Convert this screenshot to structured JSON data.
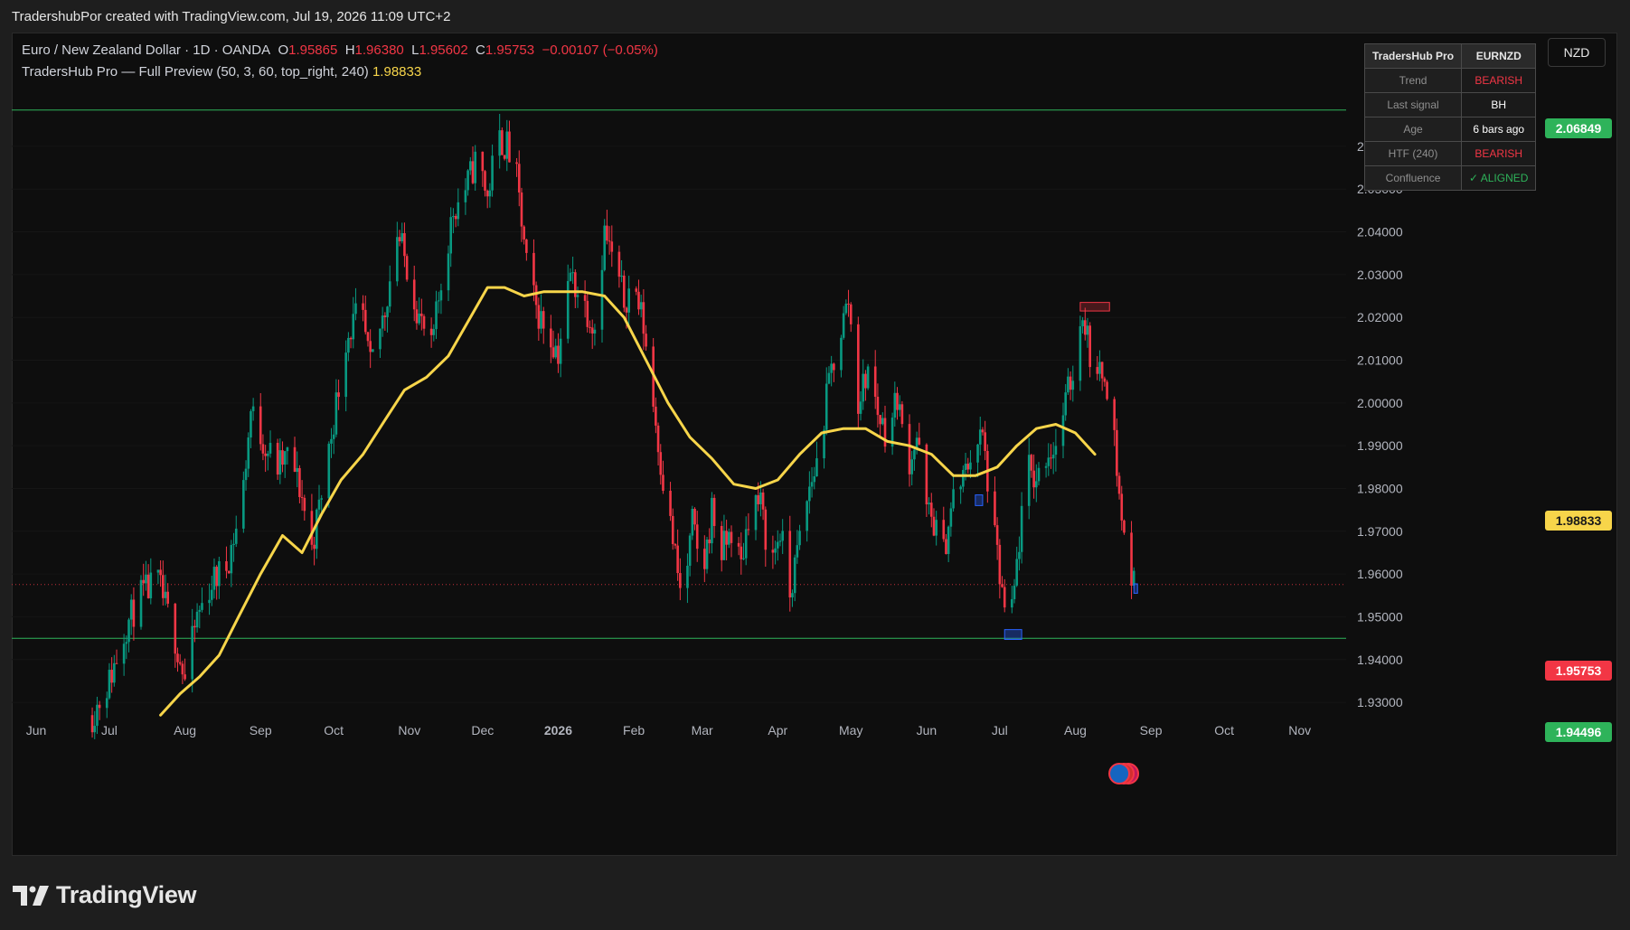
{
  "header": {
    "attribution": "TradershubPor created with TradingView.com, Jul 19, 2026 11:09 UTC+2"
  },
  "legend": {
    "symbol": "Euro / New Zealand Dollar · 1D · OANDA",
    "open_label": "O",
    "open": "1.95865",
    "high_label": "H",
    "high": "1.96380",
    "low_label": "L",
    "low": "1.95602",
    "close_label": "C",
    "close": "1.95753",
    "change": "−0.00107 (−0.05%)",
    "indicator": "TradersHub Pro — Full Preview (50, 3, 60, top_right, 240)",
    "indicator_value": "1.98833"
  },
  "currency_button": "NZD",
  "info_table": {
    "header": [
      "TradersHub Pro",
      "EURNZD"
    ],
    "rows": [
      {
        "key": "Trend",
        "value": "BEARISH",
        "color": "#f23645"
      },
      {
        "key": "Last signal",
        "value": "BH",
        "color": "#ffffff"
      },
      {
        "key": "Age",
        "value": "6 bars ago",
        "color": "#ffffff"
      },
      {
        "key": "HTF (240)",
        "value": "BEARISH",
        "color": "#f23645"
      },
      {
        "key": "Confluence",
        "value": "✓ ALIGNED",
        "color": "#2eb35a"
      }
    ]
  },
  "price_tags": {
    "resistance": "2.06849",
    "ema": "1.98833",
    "close": "1.95753",
    "support": "1.94496"
  },
  "brand": "TradingView",
  "colors": {
    "up": "#089981",
    "down": "#f23645",
    "ema": "#f7d54a",
    "level": "#2eb35a",
    "background": "#0e0e0e"
  },
  "chart_data": {
    "type": "candlestick",
    "symbol": "EURNZD",
    "timeframe": "1D",
    "ylim": [
      1.926,
      2.079
    ],
    "y_ticks": [
      "2.06000",
      "2.05000",
      "2.04000",
      "2.03000",
      "2.02000",
      "2.01000",
      "2.00000",
      "1.99000",
      "1.98000",
      "1.97000",
      "1.96000",
      "1.95000",
      "1.94000",
      "1.93000"
    ],
    "x_labels": [
      {
        "label": "Jun",
        "date": "2025-06-01"
      },
      {
        "label": "Jul",
        "date": "2025-07-01"
      },
      {
        "label": "Aug",
        "date": "2025-08-01"
      },
      {
        "label": "Sep",
        "date": "2025-09-01"
      },
      {
        "label": "Oct",
        "date": "2025-10-01"
      },
      {
        "label": "Nov",
        "date": "2025-11-01"
      },
      {
        "label": "Dec",
        "date": "2025-12-01"
      },
      {
        "label": "2026",
        "date": "2026-01-01",
        "bold": true
      },
      {
        "label": "Feb",
        "date": "2026-02-01"
      },
      {
        "label": "Mar",
        "date": "2026-03-01"
      },
      {
        "label": "Apr",
        "date": "2026-04-01"
      },
      {
        "label": "May",
        "date": "2026-05-01"
      },
      {
        "label": "Jun",
        "date": "2026-06-01"
      },
      {
        "label": "Jul",
        "date": "2026-07-01"
      },
      {
        "label": "Aug",
        "date": "2026-08-01"
      },
      {
        "label": "Sep",
        "date": "2026-09-01"
      },
      {
        "label": "Oct",
        "date": "2026-10-01"
      },
      {
        "label": "Nov",
        "date": "2026-11-01"
      }
    ],
    "x_range": [
      "2025-05-22",
      "2026-11-20"
    ],
    "last_close": 1.95753,
    "levels": [
      {
        "name": "resistance",
        "value": 2.06849
      },
      {
        "name": "support",
        "value": 1.94496
      }
    ],
    "close_path": [
      [
        "2025-06-24",
        1.927
      ],
      [
        "2025-07-01",
        1.935
      ],
      [
        "2025-07-08",
        1.948
      ],
      [
        "2025-07-14",
        1.955
      ],
      [
        "2025-07-21",
        1.958
      ],
      [
        "2025-07-28",
        1.945
      ],
      [
        "2025-08-01",
        1.935
      ],
      [
        "2025-08-06",
        1.95
      ],
      [
        "2025-08-12",
        1.958
      ],
      [
        "2025-08-18",
        1.962
      ],
      [
        "2025-08-24",
        1.975
      ],
      [
        "2025-08-28",
        1.998
      ],
      [
        "2025-09-03",
        1.99
      ],
      [
        "2025-09-08",
        1.985
      ],
      [
        "2025-09-13",
        1.988
      ],
      [
        "2025-09-18",
        1.978
      ],
      [
        "2025-09-22",
        1.966
      ],
      [
        "2025-09-27",
        1.982
      ],
      [
        "2025-10-02",
        2.0
      ],
      [
        "2025-10-06",
        2.015
      ],
      [
        "2025-10-12",
        2.022
      ],
      [
        "2025-10-16",
        2.008
      ],
      [
        "2025-10-22",
        2.022
      ],
      [
        "2025-10-27",
        2.04
      ],
      [
        "2025-11-01",
        2.03
      ],
      [
        "2025-11-05",
        2.02
      ],
      [
        "2025-11-10",
        2.012
      ],
      [
        "2025-11-14",
        2.028
      ],
      [
        "2025-11-19",
        2.045
      ],
      [
        "2025-11-24",
        2.05
      ],
      [
        "2025-11-29",
        2.058
      ],
      [
        "2025-12-03",
        2.048
      ],
      [
        "2025-12-07",
        2.062
      ],
      [
        "2025-12-11",
        2.06
      ],
      [
        "2025-12-15",
        2.052
      ],
      [
        "2025-12-19",
        2.032
      ],
      [
        "2025-12-23",
        2.022
      ],
      [
        "2025-12-28",
        2.016
      ],
      [
        "2026-01-01",
        2.012
      ],
      [
        "2026-01-06",
        2.03
      ],
      [
        "2026-01-11",
        2.024
      ],
      [
        "2026-01-16",
        2.018
      ],
      [
        "2026-01-20",
        2.04
      ],
      [
        "2026-01-24",
        2.032
      ],
      [
        "2026-01-28",
        2.024
      ],
      [
        "2026-02-01",
        2.028
      ],
      [
        "2026-02-05",
        2.018
      ],
      [
        "2026-02-09",
        2.0
      ],
      [
        "2026-02-13",
        1.982
      ],
      [
        "2026-02-17",
        1.968
      ],
      [
        "2026-02-21",
        1.952
      ],
      [
        "2026-02-25",
        1.972
      ],
      [
        "2026-03-01",
        1.958
      ],
      [
        "2026-03-05",
        1.975
      ],
      [
        "2026-03-09",
        1.965
      ],
      [
        "2026-03-13",
        1.97
      ],
      [
        "2026-03-17",
        1.962
      ],
      [
        "2026-03-21",
        1.978
      ],
      [
        "2026-03-25",
        1.976
      ],
      [
        "2026-03-29",
        1.962
      ],
      [
        "2026-04-02",
        1.97
      ],
      [
        "2026-04-06",
        1.955
      ],
      [
        "2026-04-10",
        1.968
      ],
      [
        "2026-04-14",
        1.98
      ],
      [
        "2026-04-18",
        1.988
      ],
      [
        "2026-04-22",
        2.005
      ],
      [
        "2026-04-26",
        2.015
      ],
      [
        "2026-04-30",
        2.024
      ],
      [
        "2026-05-04",
        2.0
      ],
      [
        "2026-05-08",
        2.008
      ],
      [
        "2026-05-12",
        1.998
      ],
      [
        "2026-05-16",
        1.992
      ],
      [
        "2026-05-20",
        2.002
      ],
      [
        "2026-05-24",
        1.985
      ],
      [
        "2026-05-28",
        1.992
      ],
      [
        "2026-06-01",
        1.975
      ],
      [
        "2026-06-04",
        1.972
      ],
      [
        "2026-06-08",
        1.965
      ],
      [
        "2026-06-12",
        1.978
      ],
      [
        "2026-06-16",
        1.982
      ],
      [
        "2026-06-20",
        1.99
      ],
      [
        "2026-06-24",
        1.992
      ],
      [
        "2026-06-28",
        1.972
      ],
      [
        "2026-07-02",
        1.955
      ],
      [
        "2026-07-05",
        1.945
      ],
      [
        "2026-07-08",
        1.962
      ],
      [
        "2026-07-12",
        1.985
      ],
      [
        "2026-07-16",
        1.982
      ],
      [
        "2026-07-20",
        1.988
      ],
      [
        "2026-07-24",
        1.99
      ],
      [
        "2026-07-28",
        2.0
      ],
      [
        "2026-08-01",
        2.01
      ],
      [
        "2026-08-04",
        2.022
      ],
      [
        "2026-08-07",
        2.012
      ],
      [
        "2026-08-10",
        2.005
      ],
      [
        "2026-08-13",
        2.008
      ],
      [
        "2026-08-16",
        1.998
      ],
      [
        "2026-08-19",
        1.978
      ],
      [
        "2026-08-22",
        1.964
      ],
      [
        "2026-08-25",
        1.9575
      ]
    ],
    "ema_series": [
      [
        "2025-07-22",
        1.927
      ],
      [
        "2025-07-30",
        1.932
      ],
      [
        "2025-08-07",
        1.936
      ],
      [
        "2025-08-15",
        1.941
      ],
      [
        "2025-08-23",
        1.95
      ],
      [
        "2025-09-01",
        1.96
      ],
      [
        "2025-09-10",
        1.969
      ],
      [
        "2025-09-18",
        1.965
      ],
      [
        "2025-09-26",
        1.974
      ],
      [
        "2025-10-04",
        1.982
      ],
      [
        "2025-10-13",
        1.988
      ],
      [
        "2025-10-22",
        1.996
      ],
      [
        "2025-10-30",
        2.003
      ],
      [
        "2025-11-08",
        2.006
      ],
      [
        "2025-11-17",
        2.011
      ],
      [
        "2025-11-26",
        2.02
      ],
      [
        "2025-12-03",
        2.027
      ],
      [
        "2025-12-10",
        2.027
      ],
      [
        "2025-12-18",
        2.025
      ],
      [
        "2025-12-26",
        2.026
      ],
      [
        "2026-01-03",
        2.026
      ],
      [
        "2026-01-11",
        2.026
      ],
      [
        "2026-01-20",
        2.025
      ],
      [
        "2026-01-28",
        2.02
      ],
      [
        "2026-02-06",
        2.01
      ],
      [
        "2026-02-15",
        2.0
      ],
      [
        "2026-02-24",
        1.992
      ],
      [
        "2026-03-05",
        1.987
      ],
      [
        "2026-03-14",
        1.981
      ],
      [
        "2026-03-23",
        1.98
      ],
      [
        "2026-04-01",
        1.982
      ],
      [
        "2026-04-10",
        1.988
      ],
      [
        "2026-04-19",
        1.993
      ],
      [
        "2026-04-28",
        1.994
      ],
      [
        "2026-05-07",
        1.994
      ],
      [
        "2026-05-16",
        1.991
      ],
      [
        "2026-05-25",
        1.99
      ],
      [
        "2026-06-03",
        1.988
      ],
      [
        "2026-06-12",
        1.983
      ],
      [
        "2026-06-21",
        1.983
      ],
      [
        "2026-06-30",
        1.985
      ],
      [
        "2026-07-08",
        1.99
      ],
      [
        "2026-07-16",
        1.994
      ],
      [
        "2026-07-24",
        1.995
      ],
      [
        "2026-08-01",
        1.993
      ],
      [
        "2026-08-09",
        1.988
      ]
    ],
    "signal_boxes": [
      {
        "type": "bearish",
        "date_start": "2026-08-03",
        "date_end": "2026-08-15",
        "low": 2.0215,
        "high": 2.0235
      },
      {
        "type": "bullish",
        "date_start": "2026-06-21",
        "date_end": "2026-06-24",
        "low": 1.976,
        "high": 1.9785
      },
      {
        "type": "bullish",
        "date_start": "2026-07-03",
        "date_end": "2026-07-10",
        "low": 1.9447,
        "high": 1.947
      },
      {
        "type": "bullish",
        "date_start": "2026-08-25",
        "date_end": "2026-08-26",
        "low": 1.9555,
        "high": 1.9577
      }
    ]
  }
}
